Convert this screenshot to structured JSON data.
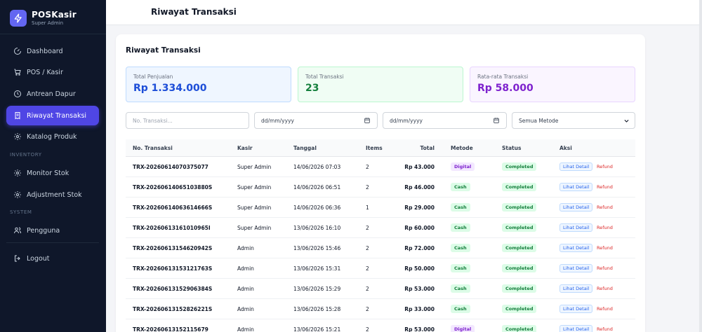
{
  "brand": {
    "title": "POSKasir",
    "subtitle": "Super Admin"
  },
  "sidebar": {
    "items": [
      {
        "label": "Dashboard",
        "icon": "dashboard-icon"
      },
      {
        "label": "POS / Kasir",
        "icon": "cart-icon"
      },
      {
        "label": "Antrean Dapur",
        "icon": "clock-icon"
      },
      {
        "label": "Riwayat Transaksi",
        "icon": "receipt-icon",
        "active": true
      },
      {
        "label": "Katalog Produk",
        "icon": "settings-icon"
      }
    ],
    "section_inventory": "INVENTORY",
    "inventory_items": [
      {
        "label": "Monitor Stok",
        "icon": "gear-icon"
      },
      {
        "label": "Adjustment Stok",
        "icon": "gear-icon"
      }
    ],
    "section_system": "SYSTEM",
    "system_items": [
      {
        "label": "Pengguna",
        "icon": "users-icon"
      }
    ],
    "logout": "Logout"
  },
  "header": {
    "title": "Riwayat Transaksi"
  },
  "main": {
    "title": "Riwayat Transaksi",
    "stats": [
      {
        "label": "Total Penjualan",
        "value": "Rp 1.334.000"
      },
      {
        "label": "Total Transaksi",
        "value": "23"
      },
      {
        "label": "Rata-rata Transaksi",
        "value": "Rp 58.000"
      }
    ],
    "filters": {
      "search_placeholder": "No. Transaksi...",
      "date_from": "dd/mm/yyyy",
      "date_to": "dd/mm/yyyy",
      "method_selected": "Semua Metode"
    },
    "table": {
      "headers": [
        "No. Transaksi",
        "Kasir",
        "Tanggal",
        "Items",
        "Total",
        "Metode",
        "Status",
        "Aksi"
      ],
      "action_detail": "Lihat Detail",
      "action_refund": "Refund",
      "rows": [
        {
          "no": "TRX-20260614070375077",
          "kasir": "Super Admin",
          "tanggal": "14/06/2026 07:03",
          "items": "2",
          "total": "Rp 43.000",
          "metode": "Digital",
          "status": "Completed"
        },
        {
          "no": "TRX-20260614065103880S",
          "kasir": "Super Admin",
          "tanggal": "14/06/2026 06:51",
          "items": "2",
          "total": "Rp 46.000",
          "metode": "Cash",
          "status": "Completed"
        },
        {
          "no": "TRX-20260614063614666S",
          "kasir": "Super Admin",
          "tanggal": "14/06/2026 06:36",
          "items": "1",
          "total": "Rp 29.000",
          "metode": "Cash",
          "status": "Completed"
        },
        {
          "no": "TRX-20260613161010965I",
          "kasir": "Super Admin",
          "tanggal": "13/06/2026 16:10",
          "items": "2",
          "total": "Rp 60.000",
          "metode": "Cash",
          "status": "Completed"
        },
        {
          "no": "TRX-20260613154620942S",
          "kasir": "Admin",
          "tanggal": "13/06/2026 15:46",
          "items": "2",
          "total": "Rp 72.000",
          "metode": "Cash",
          "status": "Completed"
        },
        {
          "no": "TRX-20260613153121763S",
          "kasir": "Admin",
          "tanggal": "13/06/2026 15:31",
          "items": "2",
          "total": "Rp 50.000",
          "metode": "Cash",
          "status": "Completed"
        },
        {
          "no": "TRX-20260613152906384S",
          "kasir": "Admin",
          "tanggal": "13/06/2026 15:29",
          "items": "2",
          "total": "Rp 53.000",
          "metode": "Cash",
          "status": "Completed"
        },
        {
          "no": "TRX-20260613152826221S",
          "kasir": "Admin",
          "tanggal": "13/06/2026 15:28",
          "items": "2",
          "total": "Rp 33.000",
          "metode": "Cash",
          "status": "Completed"
        },
        {
          "no": "TRX-20260613152115679",
          "kasir": "Admin",
          "tanggal": "13/06/2026 15:21",
          "items": "2",
          "total": "Rp 53.000",
          "metode": "Digital",
          "status": "Completed"
        }
      ]
    }
  },
  "colors": {
    "sidebar_bg": "#0f172a",
    "accent": "#4f46e5"
  }
}
